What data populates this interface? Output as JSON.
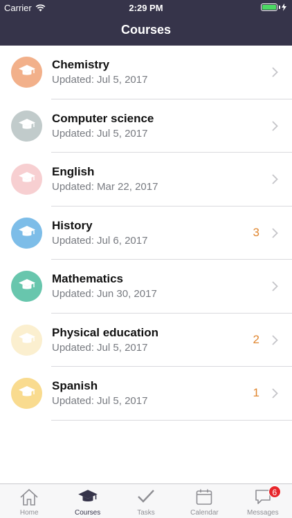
{
  "status_bar": {
    "carrier": "Carrier",
    "time": "2:29 PM",
    "battery_color": "#4cd964"
  },
  "navbar": {
    "title": "Courses"
  },
  "courses": [
    {
      "name": "Chemistry",
      "updated": "Updated: Jul 5, 2017",
      "badge": "",
      "color": "#f2b08a",
      "icon": "graduation-cap-icon"
    },
    {
      "name": "Computer science",
      "updated": "Updated: Jul 5, 2017",
      "badge": "",
      "color": "#c1cbcb",
      "icon": "graduation-cap-icon"
    },
    {
      "name": "English",
      "updated": "Updated: Mar 22, 2017",
      "badge": "",
      "color": "#f7cfd1",
      "icon": "graduation-cap-icon"
    },
    {
      "name": "History",
      "updated": "Updated: Jul 6, 2017",
      "badge": "3",
      "color": "#7dbde8",
      "icon": "graduation-cap-icon"
    },
    {
      "name": "Mathematics",
      "updated": "Updated: Jun 30, 2017",
      "badge": "",
      "color": "#68c6ad",
      "icon": "graduation-cap-icon"
    },
    {
      "name": "Physical education",
      "updated": "Updated: Jul 5, 2017",
      "badge": "2",
      "color": "#fbefcf",
      "icon": "graduation-cap-icon"
    },
    {
      "name": "Spanish",
      "updated": "Updated: Jul 5, 2017",
      "badge": "1",
      "color": "#f9db8f",
      "icon": "graduation-cap-icon"
    }
  ],
  "tabbar": {
    "tabs": [
      {
        "label": "Home",
        "icon": "home-icon",
        "active": false,
        "badge": ""
      },
      {
        "label": "Courses",
        "icon": "graduation-cap-icon",
        "active": true,
        "badge": ""
      },
      {
        "label": "Tasks",
        "icon": "checkmark-icon",
        "active": false,
        "badge": ""
      },
      {
        "label": "Calendar",
        "icon": "calendar-icon",
        "active": false,
        "badge": ""
      },
      {
        "label": "Messages",
        "icon": "chat-bubble-icon",
        "active": false,
        "badge": "6"
      }
    ]
  },
  "colors": {
    "navbar_bg": "#36344a",
    "badge_text": "#e0862f",
    "message_badge_bg": "#e7262b"
  }
}
